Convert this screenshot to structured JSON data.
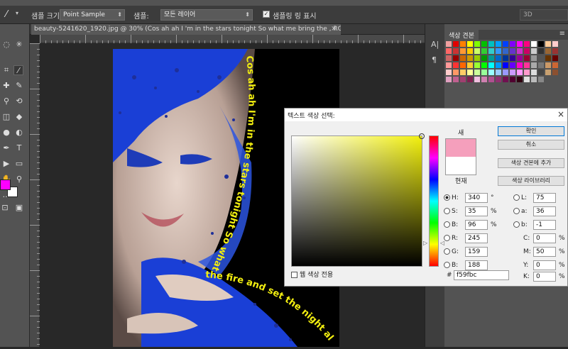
{
  "options_bar": {
    "sample_size_label": "샘플 크기:",
    "sample_size_value": "Point Sample",
    "sample_label": "샘플:",
    "sample_value": "모든 레이어",
    "show_ring_label": "샘플링 링 표시",
    "workspace_value": "3D"
  },
  "document": {
    "tab_title": "beauty-5241620_1920.jpg @ 30% (Cos ah ah I 'm  in the stars tonight So what me bring     the  , RGB/8) *",
    "tab_close": "×",
    "photo_text_1": "Cos ah ah I'm in the stars tonight So what me bring",
    "photo_text_2": "the fire and set the night alight"
  },
  "swatches_panel": {
    "tab_label": "색상 견본",
    "menu_icon": "≡",
    "colors": [
      "#f0a0a0",
      "#e00000",
      "#ff8000",
      "#ffff00",
      "#80ff00",
      "#00c000",
      "#00c0c0",
      "#00a0ff",
      "#0040ff",
      "#8000ff",
      "#ff00ff",
      "#ff0080",
      "#ffffff",
      "#000000",
      "#ffcc99",
      "#ffcccc",
      "#ff6666",
      "#cc3333",
      "#ff9933",
      "#ffcc00",
      "#ccff66",
      "#33cc33",
      "#33cccc",
      "#3399ff",
      "#3366cc",
      "#6633cc",
      "#cc33cc",
      "#cc0066",
      "#cccccc",
      "#333333",
      "#996633",
      "#993333",
      "#cc6666",
      "#990000",
      "#cc6600",
      "#cc9900",
      "#99cc00",
      "#009900",
      "#009999",
      "#0066cc",
      "#003399",
      "#330099",
      "#990099",
      "#990033",
      "#999999",
      "#555555",
      "#663300",
      "#660000",
      "#ff9999",
      "#ff3333",
      "#ff6600",
      "#ffcc33",
      "#99ff33",
      "#00ff00",
      "#00ffff",
      "#0099ff",
      "#0000ff",
      "#6600ff",
      "#ff00cc",
      "#ff3399",
      "#aaaaaa",
      "#777777",
      "#cc9966",
      "#cc6633",
      "#ffcccc",
      "#ff9966",
      "#ffcc66",
      "#ffff99",
      "#ccff99",
      "#99ff99",
      "#99ffff",
      "#99ccff",
      "#9999ff",
      "#cc99ff",
      "#ff99ff",
      "#ff99cc",
      "#dddddd",
      "#444444",
      "#c8a070",
      "#8c5030",
      "#e0a0c0",
      "#c06090",
      "#a04070",
      "#802050",
      "#f0c0e0",
      "#d080b0",
      "#b05090",
      "#903070",
      "#701050",
      "#500030",
      "#300010",
      "#e0e0e0",
      "#bbbbbb",
      "#888888"
    ]
  },
  "dialog": {
    "title": "텍스트 색상 선택:",
    "close": "×",
    "new_label": "새",
    "current_label": "현재",
    "ok": "확인",
    "cancel": "취소",
    "add_swatch": "색상 견본에 추가",
    "color_libraries": "색상 라이브러리",
    "web_only": "웹 색상 전용",
    "new_color": "#f59fbc",
    "current_color": "#ffffff",
    "H": {
      "label": "H:",
      "value": "340",
      "unit": "°"
    },
    "S": {
      "label": "S:",
      "value": "35",
      "unit": "%"
    },
    "B": {
      "label": "B:",
      "value": "96",
      "unit": "%"
    },
    "R": {
      "label": "R:",
      "value": "245"
    },
    "G": {
      "label": "G:",
      "value": "159"
    },
    "Bl": {
      "label": "B:",
      "value": "188"
    },
    "L": {
      "label": "L:",
      "value": "75"
    },
    "a": {
      "label": "a:",
      "value": "36"
    },
    "b": {
      "label": "b:",
      "value": "-1"
    },
    "C": {
      "label": "C:",
      "value": "0",
      "unit": "%"
    },
    "M": {
      "label": "M:",
      "value": "50",
      "unit": "%"
    },
    "Y": {
      "label": "Y:",
      "value": "0",
      "unit": "%"
    },
    "K": {
      "label": "K:",
      "value": "0",
      "unit": "%"
    },
    "hex_label": "#",
    "hex": "f59fbc"
  },
  "toolbox": {
    "foreground_color": "#ff00ff",
    "background_color": "#ffffff"
  }
}
